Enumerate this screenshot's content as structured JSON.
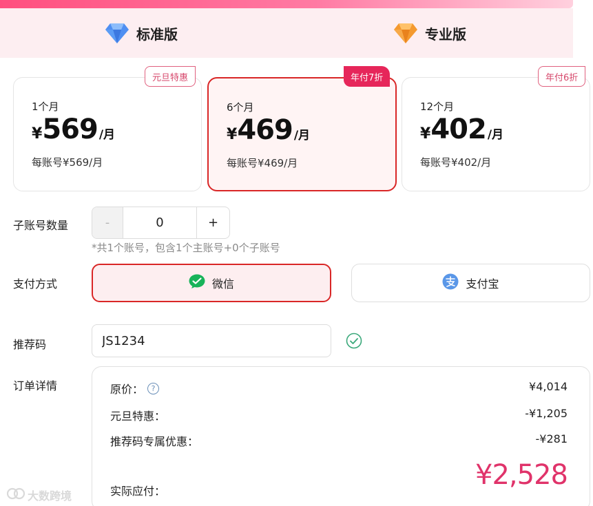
{
  "tabs": [
    {
      "label": "标准版",
      "icon": "blue-diamond-icon"
    },
    {
      "label": "专业版",
      "icon": "orange-diamond-icon"
    }
  ],
  "plans": [
    {
      "duration": "1个月",
      "currency": "¥",
      "price": "569",
      "unit": "/月",
      "per_account": "每账号¥569/月",
      "badge": "元旦特惠",
      "selected": false
    },
    {
      "duration": "6个月",
      "currency": "¥",
      "price": "469",
      "unit": "/月",
      "per_account": "每账号¥469/月",
      "badge": "年付7折",
      "selected": true
    },
    {
      "duration": "12个月",
      "currency": "¥",
      "price": "402",
      "unit": "/月",
      "per_account": "每账号¥402/月",
      "badge": "年付6折",
      "selected": false
    }
  ],
  "sub_accounts": {
    "label": "子账号数量",
    "minus": "-",
    "value": "0",
    "plus": "+",
    "note": "*共1个账号，包含1个主账号+0个子账号"
  },
  "payment": {
    "label": "支付方式",
    "methods": [
      {
        "label": "微信",
        "icon": "wechat-icon",
        "selected": true
      },
      {
        "label": "支付宝",
        "icon": "alipay-icon",
        "selected": false
      }
    ]
  },
  "referral": {
    "label": "推荐码",
    "value": "JS1234"
  },
  "order": {
    "label": "订单详情",
    "original_label": "原价：",
    "original_value": "¥4,014",
    "promo_label": "元旦特惠：",
    "promo_value": "-¥1,205",
    "referral_label": "推荐码专属优惠：",
    "referral_value": "-¥281",
    "total_label": "实际应付：",
    "total_value": "¥2,528"
  },
  "watermark": "大数跨境",
  "colors": {
    "accent_red": "#d92626",
    "badge_pink": "#e6265a",
    "total_pink": "#e0336a",
    "tab_bg": "#fdeef1"
  }
}
